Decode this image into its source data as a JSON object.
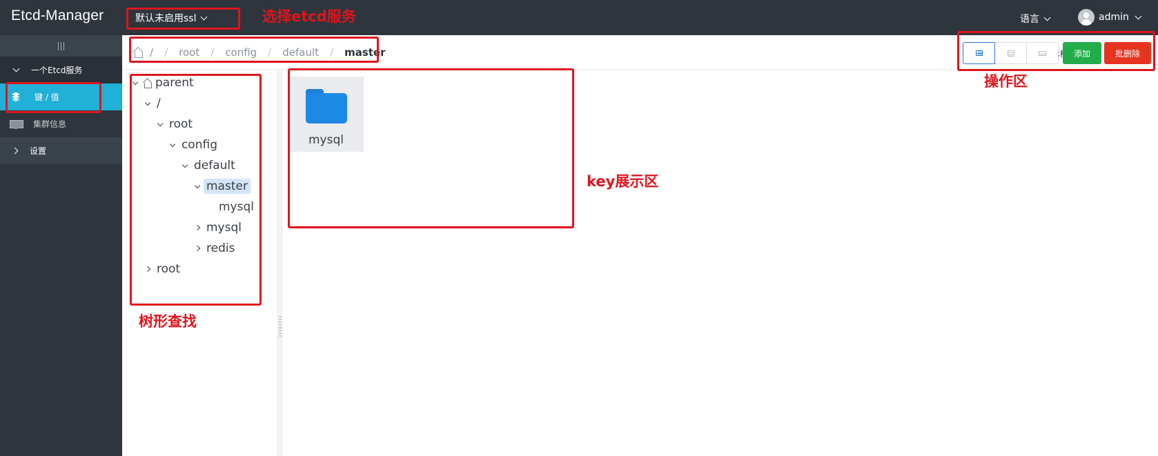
{
  "app": {
    "title": "Etcd-Manager"
  },
  "header": {
    "service_select": "默认未启用ssl",
    "language": "语言",
    "user": "admin"
  },
  "sidebar": {
    "group_label": "一个Etcd服务",
    "items": [
      {
        "label": "键 / 值",
        "icon": "layers-icon",
        "active": true
      },
      {
        "label": "集群信息",
        "icon": "monitor-icon",
        "active": false
      }
    ],
    "settings_label": "设置"
  },
  "breadcrumb": {
    "items": [
      "/",
      "root",
      "config",
      "default"
    ],
    "current": "master"
  },
  "toolbar": {
    "show_tree_label": "显示树形",
    "show_tree_checked": true,
    "view_modes": [
      "grid-icon",
      "list-icon",
      "card-icon"
    ],
    "active_view": "grid-icon",
    "add_label": "添加",
    "batch_delete_label": "批删除"
  },
  "tree": {
    "nodes": [
      {
        "label": "parent",
        "expanded": true,
        "icon": "home-icon"
      },
      {
        "label": "/",
        "expanded": true
      },
      {
        "label": "root",
        "expanded": true
      },
      {
        "label": "config",
        "expanded": true
      },
      {
        "label": "default",
        "expanded": true
      },
      {
        "label": "master",
        "expanded": true,
        "selected": true
      },
      {
        "label": "mysql",
        "leaf": true
      },
      {
        "label": "mysql",
        "expanded": false
      },
      {
        "label": "redis",
        "expanded": false
      },
      {
        "label": "root",
        "expanded": false
      }
    ]
  },
  "content": {
    "items": [
      {
        "label": "mysql",
        "type": "folder"
      }
    ]
  },
  "annotations": {
    "select_service": "选择etcd服务",
    "operation_area": "操作区",
    "key_display_area": "key展示区",
    "tree_search": "树形查找"
  },
  "colors": {
    "topbar": "#2f353d",
    "active_menu": "#21b0d8",
    "add_button": "#22ad4b",
    "delete_button": "#e5341f",
    "folder": "#1e88e5",
    "annotation": "#e0141c"
  }
}
